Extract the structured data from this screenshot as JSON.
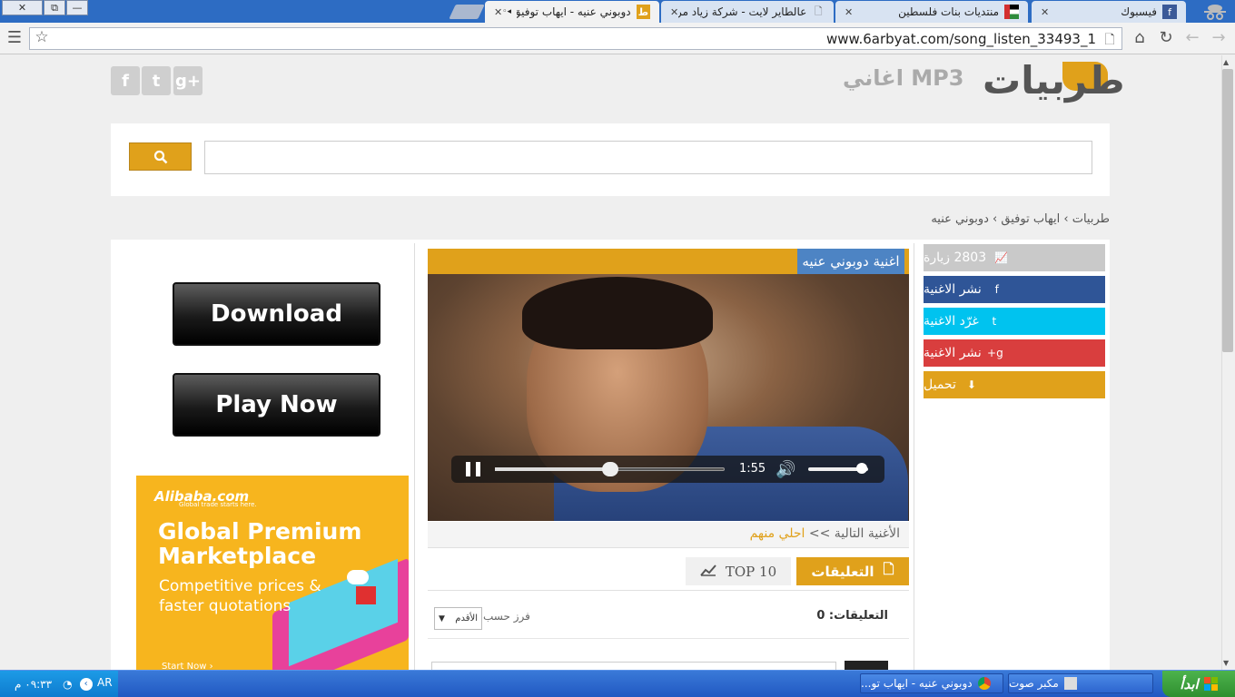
{
  "browser": {
    "window_buttons": [
      "✕",
      "⧉",
      "—"
    ],
    "tabs": [
      {
        "title": "فيسبوك",
        "favicon_color": "#3b5998",
        "favicon": "f"
      },
      {
        "title": "منتديات بنات فلسطين",
        "favicon_color": "#2e8b3c",
        "favicon": ""
      },
      {
        "title": "عالطاير لايت - شركة زياد مرتجى",
        "favicon_color": "#888888",
        "favicon": "🗋"
      },
      {
        "title": "دوبوني عنيه - ايهاب توفيق",
        "favicon_color": "#e0a11b",
        "favicon": "ط",
        "active": true
      }
    ],
    "close_glyph": "✕",
    "url": "www.6arbyat.com/song_listen_33493_1"
  },
  "header": {
    "logo_text": "طربيات",
    "logo_subtitle": "MP3 اغاني",
    "social": [
      "g+",
      "t",
      "f"
    ]
  },
  "search": {
    "placeholder": "",
    "button_icon": "search-icon"
  },
  "breadcrumb": {
    "items": [
      "طربيات",
      "ايهاب توفيق",
      "دوبوني عنيه"
    ],
    "separator": "›"
  },
  "sidebar": {
    "visits": "2803 زيارة",
    "buttons": [
      {
        "label": "نشر الاغنية",
        "icon": "f",
        "color": "#2f5597"
      },
      {
        "label": "غرّد الاغنية",
        "icon": "t",
        "color": "#00c3ef"
      },
      {
        "label": "نشر الاغنية",
        "icon": "g+",
        "color": "#d93e3e"
      },
      {
        "label": "تحميل",
        "icon": "⬇",
        "color": "#e0a11b"
      }
    ]
  },
  "player": {
    "title": "اغنية دوبوني عنيه",
    "time": "1:55",
    "progress": 0.5,
    "volume": 0.9
  },
  "next": {
    "label": "الأغنية التالية >>",
    "song": "احلي منهم"
  },
  "tabs": {
    "comments": "التعليقات",
    "top10": "TOP 10"
  },
  "comments": {
    "count_label": "التعليقات:",
    "count": "0",
    "sort_label": "فرز حسب",
    "sort_value": "الأقدم"
  },
  "ads": {
    "download": "Download",
    "play_now": "Play Now",
    "alibaba": {
      "logo": "Alibaba.com",
      "tagline": "Global trade starts here.",
      "headline": "Global Premium Marketplace",
      "body": "Competitive prices & faster quotations",
      "cta": "Start Now ›"
    }
  },
  "taskbar": {
    "start": "ابدأ",
    "items": [
      "مكبر صوت",
      "دوبوني عنيه - ايهاب تو..."
    ],
    "lang": "AR",
    "clock": "٠٩:٣٣ م"
  },
  "colors": {
    "accent": "#e0a11b",
    "facebook": "#2f5597",
    "twitter": "#00c3ef",
    "gplus": "#d93e3e"
  }
}
